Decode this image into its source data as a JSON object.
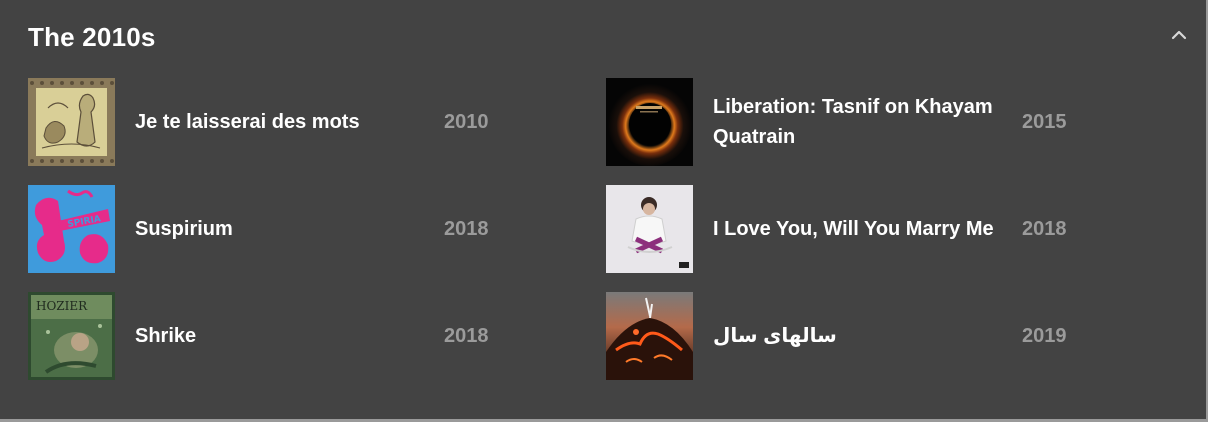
{
  "section": {
    "title": "The 2010s",
    "collapse_icon": "chevron-up-icon"
  },
  "albums": [
    {
      "title": "Je te laisserai des mots",
      "year": "2010",
      "cover": "vintage-engraving-art"
    },
    {
      "title": "Suspirium",
      "year": "2018",
      "cover": "pink-hand-on-blue-art"
    },
    {
      "title": "Shrike",
      "year": "2018",
      "cover": "underwater-green-art"
    },
    {
      "title": "Liberation: Tasnif on Khayam Quatrain",
      "year": "2015",
      "cover": "solar-eclipse-ring-art"
    },
    {
      "title": "I Love You, Will You Marry Me",
      "year": "2018",
      "cover": "seated-figure-white-art"
    },
    {
      "title": "سالهای سال",
      "year": "2019",
      "cover": "lava-volcano-art"
    }
  ],
  "colors": {
    "panel_bg": "#434343",
    "title_text": "#ffffff",
    "year_text": "#9b9b9b"
  }
}
